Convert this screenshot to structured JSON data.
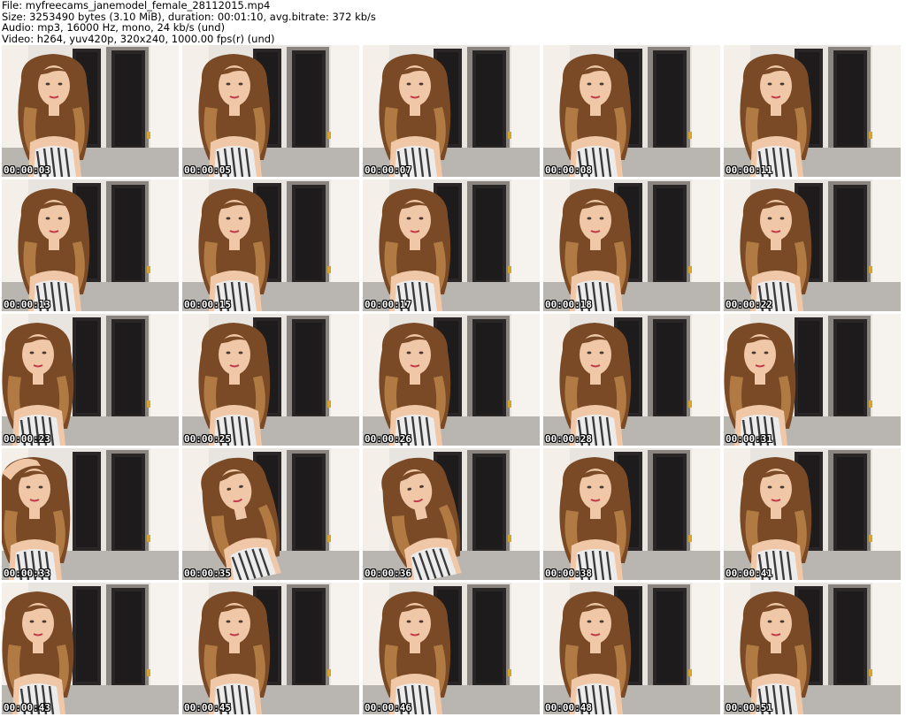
{
  "header": {
    "file": "File: myfreecams_janemodel_female_28112015.mp4",
    "size": "Size: 3253490 bytes (3.10 MiB), duration: 00:01:10, avg.bitrate: 372 kb/s",
    "audio": "Audio: mp3, 16000 Hz, mono, 24 kb/s (und)",
    "video": "Video: h264, yuv420p, 320x240, 1000.00 fps(r) (und)"
  },
  "thumbnails": [
    {
      "time": "00:00:03",
      "pose": "center"
    },
    {
      "time": "00:00:05",
      "pose": "center"
    },
    {
      "time": "00:00:07",
      "pose": "center"
    },
    {
      "time": "00:00:08",
      "pose": "center"
    },
    {
      "time": "00:00:11",
      "pose": "center"
    },
    {
      "time": "00:00:13",
      "pose": "center"
    },
    {
      "time": "00:00:15",
      "pose": "center"
    },
    {
      "time": "00:00:17",
      "pose": "center"
    },
    {
      "time": "00:00:18",
      "pose": "center"
    },
    {
      "time": "00:00:22",
      "pose": "center"
    },
    {
      "time": "00:00:23",
      "pose": "left"
    },
    {
      "time": "00:00:25",
      "pose": "center"
    },
    {
      "time": "00:00:26",
      "pose": "center"
    },
    {
      "time": "00:00:28",
      "pose": "center"
    },
    {
      "time": "00:00:31",
      "pose": "left"
    },
    {
      "time": "00:00:33",
      "pose": "arm-up"
    },
    {
      "time": "00:00:35",
      "pose": "tilted"
    },
    {
      "time": "00:00:36",
      "pose": "tilted"
    },
    {
      "time": "00:00:38",
      "pose": "center"
    },
    {
      "time": "00:00:41",
      "pose": "center"
    },
    {
      "time": "00:00:43",
      "pose": "left"
    },
    {
      "time": "00:00:45",
      "pose": "center"
    },
    {
      "time": "00:00:46",
      "pose": "center"
    },
    {
      "time": "00:00:48",
      "pose": "center"
    },
    {
      "time": "00:00:51",
      "pose": "center"
    }
  ],
  "colors": {
    "wall": "#e8e4df",
    "door": "#2a2628",
    "floor": "#b9b6b2",
    "hair": "#7a4a26",
    "hair_light": "#b07a42",
    "skin": "#f0c8a8",
    "stripes": "#3a3a3a"
  }
}
